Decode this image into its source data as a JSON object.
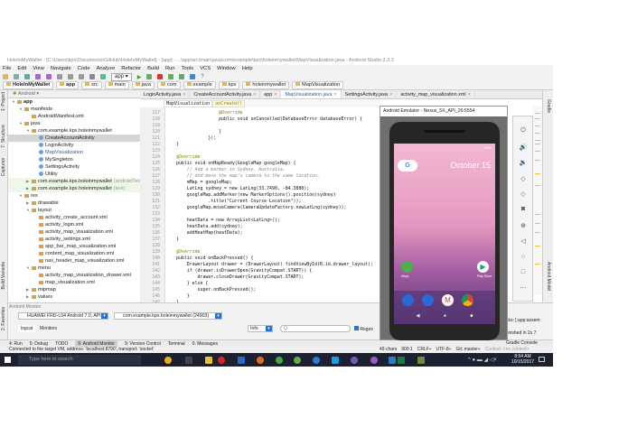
{
  "window": {
    "title": "HoleInMyWallet - [C:\\Users\\kpx\\Documents\\GitHub\\HoleInMyWallet] - [app] - ...\\app\\src\\main\\java\\com\\example\\kpx\\holeinmywallet\\MapVisualization.java - Android Studio 2.3.3"
  },
  "menu": [
    "File",
    "Edit",
    "View",
    "Navigate",
    "Code",
    "Analyze",
    "Refactor",
    "Build",
    "Run",
    "Tools",
    "VCS",
    "Window",
    "Help"
  ],
  "toolbar": {
    "run_config": "app",
    "help": "?"
  },
  "breadcrumb": [
    "HoleInMyWallet",
    "app",
    "src",
    "main",
    "java",
    "com",
    "example",
    "kpx",
    "holeinmywallet",
    "MapVisualization"
  ],
  "project": {
    "view": "Android",
    "tree": [
      {
        "label": "app",
        "level": 0,
        "icon": "folder",
        "open": true,
        "bold": true
      },
      {
        "label": "manifests",
        "level": 1,
        "icon": "folder",
        "open": true
      },
      {
        "label": "AndroidManifest.xml",
        "level": 2,
        "icon": "xml"
      },
      {
        "label": "java",
        "level": 1,
        "icon": "folder",
        "open": true
      },
      {
        "label": "com.example.kpx.holeinmywallet",
        "level": 2,
        "icon": "folder",
        "open": true
      },
      {
        "label": "CreateAccountActivity",
        "level": 3,
        "icon": "class",
        "selected": true
      },
      {
        "label": "LoginActivity",
        "level": 3,
        "icon": "class"
      },
      {
        "label": "MapVisualization",
        "level": 3,
        "icon": "class",
        "blue": true
      },
      {
        "label": "MySingleton",
        "level": 3,
        "icon": "class"
      },
      {
        "label": "SettingsActivity",
        "level": 3,
        "icon": "class"
      },
      {
        "label": "Utility",
        "level": 3,
        "icon": "class"
      },
      {
        "label": "com.example.kpx.holeinmywallet",
        "suffix": "(androidTest)",
        "level": 2,
        "icon": "folder",
        "green": true
      },
      {
        "label": "com.example.kpx.holeinmywallet",
        "suffix": "(test)",
        "level": 2,
        "icon": "folder",
        "green": true
      },
      {
        "label": "res",
        "level": 1,
        "icon": "folder",
        "open": true
      },
      {
        "label": "drawable",
        "level": 2,
        "icon": "folder"
      },
      {
        "label": "layout",
        "level": 2,
        "icon": "folder",
        "open": true
      },
      {
        "label": "activity_create_account.xml",
        "level": 3,
        "icon": "xml"
      },
      {
        "label": "activity_login.xml",
        "level": 3,
        "icon": "xml"
      },
      {
        "label": "activity_map_visualization.xml",
        "level": 3,
        "icon": "xml"
      },
      {
        "label": "activity_settings.xml",
        "level": 3,
        "icon": "xml"
      },
      {
        "label": "app_bar_map_visualization.xml",
        "level": 3,
        "icon": "xml"
      },
      {
        "label": "content_map_visualization.xml",
        "level": 3,
        "icon": "xml"
      },
      {
        "label": "nav_header_map_visualization.xml",
        "level": 3,
        "icon": "xml"
      },
      {
        "label": "menu",
        "level": 2,
        "icon": "folder",
        "open": true
      },
      {
        "label": "activity_map_visualization_drawer.xml",
        "level": 3,
        "icon": "xml"
      },
      {
        "label": "map_visualization.xml",
        "level": 3,
        "icon": "xml"
      },
      {
        "label": "mipmap",
        "level": 2,
        "icon": "folder"
      },
      {
        "label": "values",
        "level": 2,
        "icon": "folder"
      }
    ]
  },
  "tabs": [
    {
      "label": "LoginActivity.java"
    },
    {
      "label": "CreateAccountActivity.java"
    },
    {
      "label": "app"
    },
    {
      "label": "MapVisualization.java",
      "active": true
    },
    {
      "label": "SettingsActivity.java"
    },
    {
      "label": "activity_map_visualization.xml"
    }
  ],
  "editor": {
    "crumb_class": "MapVisualization",
    "crumb_method": "onCreate()",
    "first_line": 117,
    "lines": [
      "                @Override",
      "                public void onCancelled(DatabaseError databaseError) {",
      "",
      "                }",
      "            });",
      "}",
      "",
      "@Override",
      "public void onMapReady(GoogleMap googleMap) {",
      "    // Add a marker in Sydney, Australia,",
      "    // and move the map's camera to the same location.",
      "    mMap = googleMap;",
      "    LatLng sydney = new LatLng(33.7490, -84.3880);",
      "    googleMap.addMarker(new MarkerOptions().position(sydney)",
      "            .title(\"Current Course Location\"));",
      "    googleMap.moveCamera(CameraUpdateFactory.newLatLng(sydney));",
      "",
      "    heatData = new ArrayList<LatLng>();",
      "    heatData.add(sydney);",
      "    addHeatMap(heatData);",
      "}",
      "",
      "@Override",
      "public void onBackPressed() {",
      "    DrawerLayout drawer = (DrawerLayout) findViewById(R.id.drawer_layout);",
      "    if (drawer.isDrawerOpen(GravityCompat.START)) {",
      "        drawer.closeDrawer(GravityCompat.START);",
      "    } else {",
      "        super.onBackPressed();",
      "    }",
      "}"
    ]
  },
  "side_labels": {
    "project": "1: Project",
    "structure": "7: Structure",
    "captures": "Captures",
    "build_variants": "Build Variants",
    "favorites": "2: Favorites",
    "gradle": "Gradle",
    "android_model": "Android Model"
  },
  "monitor": {
    "title": "Android Monitor",
    "device": "HUAWEI FRD-L04 Android 7.0, API 24",
    "process": "com.example.kpx.holeinmywallet (24903)",
    "tab_logcat": "logcat",
    "tab_monitors": "Monitors",
    "level": "Info",
    "search_placeholder": "Q-",
    "regex": "Regex",
    "gradle_line1": "sks: [:app:assem",
    "gradle_line2": "finished in 2s 7"
  },
  "tool_buttons": [
    "4: Run",
    "5: Debug",
    "TODO",
    "6: Android Monitor",
    "9: Version Control",
    "Terminal",
    "0: Messages"
  ],
  "gradle_console": "Gradle Console",
  "status": {
    "message": "Connected to the target VM, address: 'localhost:8790', transport: 'socket'",
    "chars": "49 chars",
    "position": "900:1",
    "line_sep": "CRLF÷",
    "encoding": "UTF-8÷",
    "git": "Git: master÷",
    "context": "Context: <no context>"
  },
  "taskbar": {
    "search": "Type here to search",
    "time": "8:54 AM",
    "date": "10/15/2017"
  },
  "emulator": {
    "title": "Android Emulator - Nexus_5X_API_26:5554",
    "clock": "8:54",
    "date": "October 15",
    "maps": "Maps",
    "play_store": "Play Store"
  }
}
